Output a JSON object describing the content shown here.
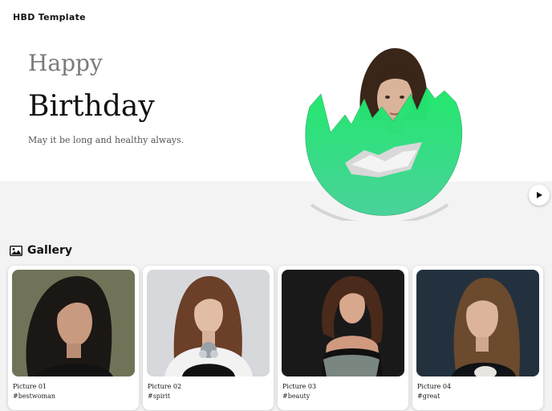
{
  "header": {
    "brand": "HBD Template"
  },
  "hero": {
    "line1": "Happy",
    "line2": "Birthday",
    "wish": "May it be long and healthy always.",
    "accent": "#2fe08a"
  },
  "player": {
    "icon": "play-icon"
  },
  "gallery": {
    "title": "Gallery",
    "icon": "image-icon",
    "items": [
      {
        "title": "Picture 01",
        "tag": "#bestwoman"
      },
      {
        "title": "Picture 02",
        "tag": "#spirit"
      },
      {
        "title": "Picture 03",
        "tag": "#beauty"
      },
      {
        "title": "Picture 04",
        "tag": "#great"
      }
    ]
  }
}
